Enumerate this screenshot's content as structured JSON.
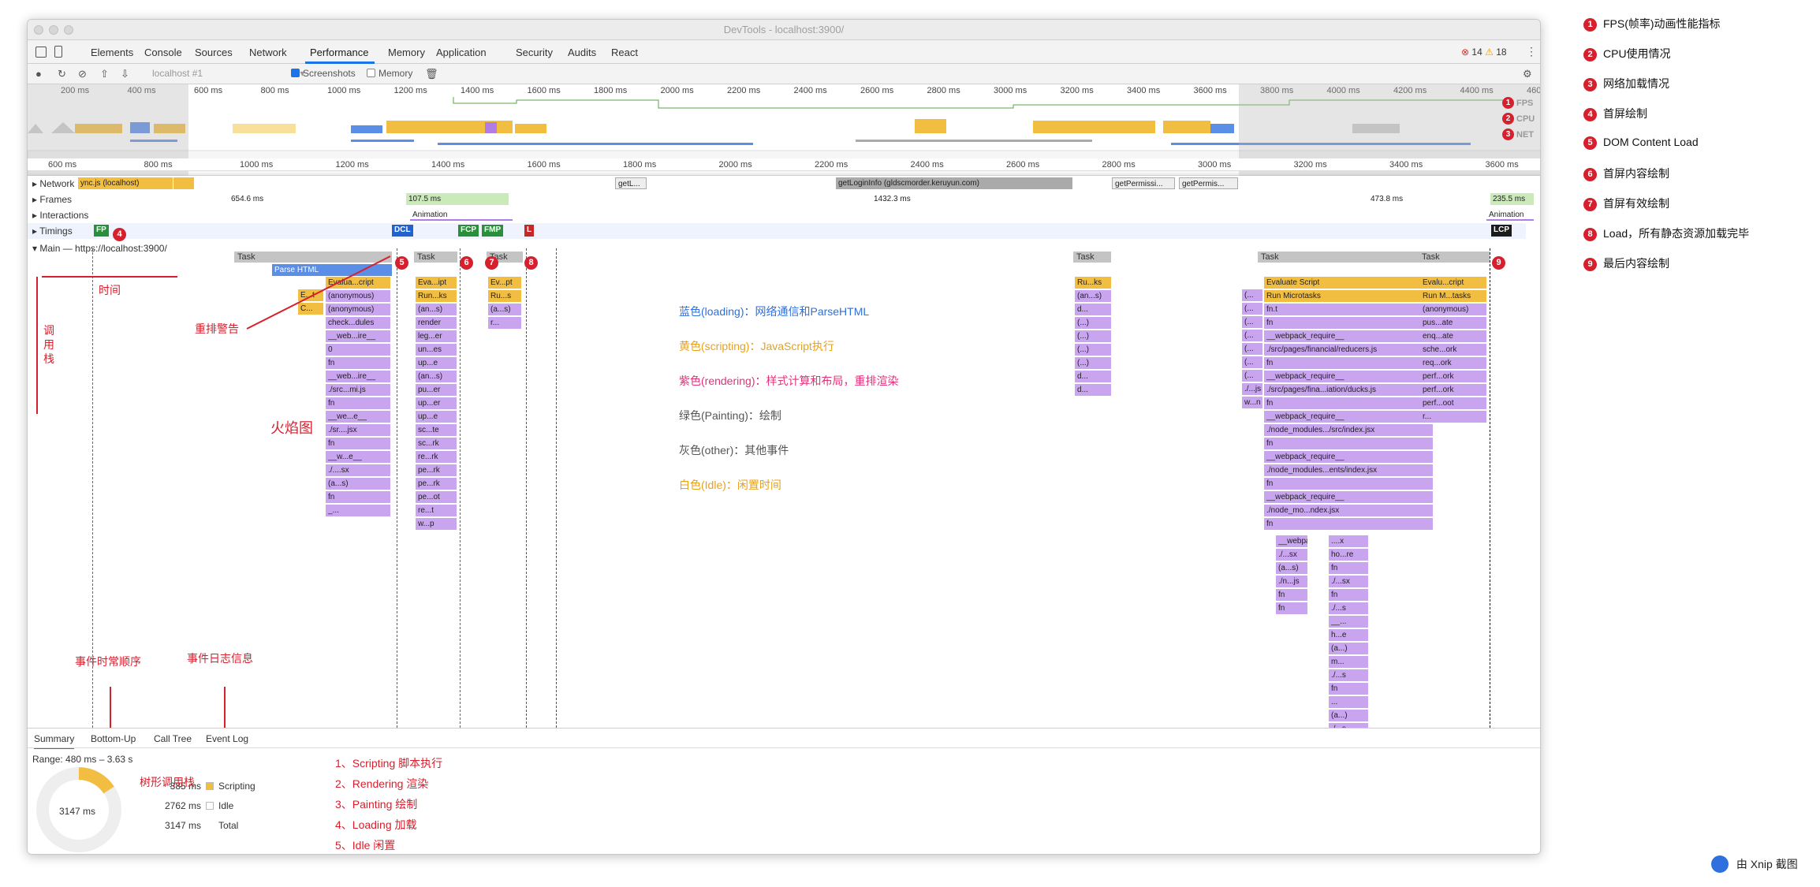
{
  "window": {
    "title": "DevTools - localhost:3900/"
  },
  "tabs": [
    "Elements",
    "Console",
    "Sources",
    "Network",
    "Performance",
    "Memory",
    "Application",
    "Security",
    "Audits",
    "React"
  ],
  "active_tab": "Performance",
  "errors": {
    "error_count": "14",
    "warning_count": "18"
  },
  "toolbar": {
    "target": "localhost #1",
    "screenshots_label": "Screenshots",
    "memory_label": "Memory"
  },
  "overview": {
    "ticks": [
      "200 ms",
      "400 ms",
      "600 ms",
      "800 ms",
      "1000 ms",
      "1200 ms",
      "1400 ms",
      "1600 ms",
      "1800 ms",
      "2000 ms",
      "2200 ms",
      "2400 ms",
      "2600 ms",
      "2800 ms",
      "3000 ms",
      "3200 ms",
      "3400 ms",
      "3600 ms",
      "3800 ms",
      "4000 ms",
      "4200 ms",
      "4400 ms",
      "460"
    ],
    "lanes": [
      "FPS",
      "CPU",
      "NET"
    ]
  },
  "detail_ruler": [
    "600 ms",
    "800 ms",
    "1000 ms",
    "1200 ms",
    "1400 ms",
    "1600 ms",
    "1800 ms",
    "2000 ms",
    "2200 ms",
    "2400 ms",
    "2600 ms",
    "2800 ms",
    "3000 ms",
    "3200 ms",
    "3400 ms",
    "3600 ms"
  ],
  "tracks": {
    "network": {
      "label": "Network",
      "items": [
        "ync.js (localhost)",
        "getL...",
        "getLoginInfo (gldscmorder.keruyun.com)",
        "getPermissi...",
        "getPermis..."
      ]
    },
    "frames": {
      "label": "Frames",
      "items": [
        "654.6 ms",
        "107.5 ms",
        "1432.3 ms",
        "473.8 ms",
        "235.5 ms"
      ]
    },
    "interactions": {
      "label": "Interactions",
      "items": [
        "Animation",
        "Animation"
      ]
    },
    "timings": {
      "label": "Timings",
      "markers": [
        "FP",
        "DCL",
        "FCP",
        "FMP",
        "L",
        "LCP"
      ]
    },
    "main": {
      "label": "Main — https://localhost:3900/"
    }
  },
  "flame": {
    "task_label": "Task",
    "parse_html": "Parse HTML",
    "col1": [
      "Evalua...cript",
      "(anonymous)",
      "(anonymous)",
      "check...dules",
      "__web...ire__",
      "0",
      "fn",
      "__web...ire__",
      "./src...mi.js",
      "fn",
      "__we...e__",
      "./sr....jsx",
      "fn",
      "__w...e__",
      "./....sx",
      "(a...s)",
      "fn",
      "_..."
    ],
    "col1_left": [
      "E...t",
      "C..."
    ],
    "col2": [
      "Eva...ipt",
      "Run...ks",
      "(an...s)",
      "render",
      "leg...er",
      "un...es",
      "up...e",
      "(an...s)",
      "pu...er",
      "up...er",
      "up...e",
      "sc...te",
      "sc...rk",
      "re...rk",
      "pe...rk",
      "pe...rk",
      "pe...ot",
      "re...t",
      "w...p"
    ],
    "col3": [
      "Ev...pt",
      "Ru...s",
      "(a...s)",
      "r..."
    ],
    "col4": [
      "Ru...ks",
      "(an...s)",
      "d...",
      "(...)",
      "(...)",
      "(...)",
      "(...)",
      "d...",
      "d..."
    ],
    "col5": [
      "Evaluate Script",
      "Run Microtasks",
      "fn.t",
      "fn",
      "__webpack_require__",
      "./src/pages/financial/reducers.js",
      "fn",
      "__webpack_require__",
      "./src/pages/fina...iation/ducks.js",
      "fn",
      "__webpack_require__",
      "./node_modules.../src/index.jsx",
      "fn",
      "__webpack_require__",
      "./node_modules...ents/index.jsx",
      "fn",
      "__webpack_require__",
      "./node_mo...ndex.jsx",
      "fn"
    ],
    "col5_side": [
      "(...",
      "(...",
      "(...",
      "(...",
      "(...",
      "(...",
      "(...",
      "./...js",
      "w...n"
    ],
    "col5_nested": [
      "__webpack_require__",
      "./...sx",
      "(a...s)",
      "./n...js",
      "fn",
      "fn"
    ],
    "col5_nested2": [
      "....x",
      "ho...re",
      "fn",
      "./...sx",
      "fn",
      "./...s",
      "__...",
      "h...e",
      "(a...)",
      "m...",
      "./...s",
      "fn",
      "...",
      "(a...)",
      "./...s",
      "fn",
      "...",
      "h...",
      "...s",
      "(...)"
    ],
    "col6": [
      "Evalu...cript",
      "Run M...tasks",
      "(anonymous)",
      "pus...ate",
      "enq...ate",
      "sche...ork",
      "req...ork",
      "perf...ork",
      "perf...ork",
      "perf...oot",
      "r..."
    ]
  },
  "annotations": {
    "time": "时间",
    "call_stack": "调用栈",
    "reflow_warning": "重排警告",
    "flame_graph": "火焰图",
    "event_order": "事件时常顺序",
    "event_log": "事件日志信息",
    "tree_call_stack": "树形调用栈",
    "colors": [
      {
        "text": "蓝色(loading)：网络通信和ParseHTML",
        "color": "#2f6fde"
      },
      {
        "text": "黄色(scripting)：JavaScript执行",
        "color": "#e6a11e"
      },
      {
        "text": "紫色(rendering)：样式计算和布局，重排渲染",
        "color": "#e0327a"
      },
      {
        "text": "绿色(Painting)：绘制",
        "color": "#555555"
      },
      {
        "text": "灰色(other)：其他事件",
        "color": "#555555"
      },
      {
        "text": "白色(Idle)：闲置时间",
        "color": "#e6a11e"
      }
    ],
    "summary_list": [
      "1、Scripting 脚本执行",
      "2、Rendering 渲染",
      "3、Painting 绘制",
      "4、Loading 加载",
      "5、Idle 闲置"
    ]
  },
  "bottom_tabs": [
    "Summary",
    "Bottom-Up",
    "Call Tree",
    "Event Log"
  ],
  "summary": {
    "range": "Range: 480 ms – 3.63 s",
    "total_center": "3147 ms",
    "rows": [
      {
        "value": "385 ms",
        "label": "Scripting",
        "color": "#f2be42"
      },
      {
        "value": "2762 ms",
        "label": "Idle",
        "color": "#ffffff"
      },
      {
        "value": "3147 ms",
        "label": "Total",
        "color": ""
      }
    ]
  },
  "legend": [
    {
      "num": "1",
      "text": "FPS(帧率)动画性能指标"
    },
    {
      "num": "2",
      "text": "CPU使用情况"
    },
    {
      "num": "3",
      "text": "网络加载情况"
    },
    {
      "num": "4",
      "text": "首屏绘制"
    },
    {
      "num": "5",
      "text": "DOM Content Load"
    },
    {
      "num": "6",
      "text": "首屏内容绘制"
    },
    {
      "num": "7",
      "text": "首屏有效绘制"
    },
    {
      "num": "8",
      "text": "Load，所有静态资源加载完毕"
    },
    {
      "num": "9",
      "text": "最后内容绘制"
    }
  ],
  "badge_numbers": [
    "1",
    "2",
    "3",
    "4",
    "5",
    "6",
    "7",
    "8",
    "9"
  ],
  "xnip": {
    "text": "由 Xnip 截图"
  }
}
